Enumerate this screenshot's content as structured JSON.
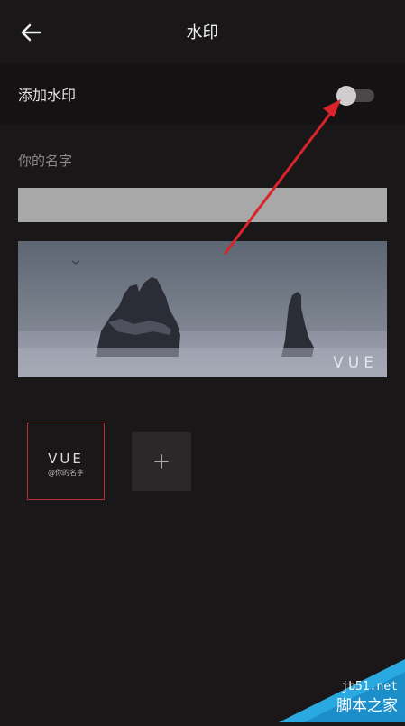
{
  "header": {
    "title": "水印",
    "back_icon": "arrow-left-icon"
  },
  "settings": {
    "add_watermark_label": "添加水印",
    "add_watermark_enabled": false,
    "name_label": "你的名字",
    "name_value": ""
  },
  "preview": {
    "watermark_text": "VUE"
  },
  "styles": {
    "thumb_title": "VUE",
    "thumb_subtitle": "@你的名字",
    "add_icon": "plus-icon"
  },
  "site_watermark": {
    "domain": "jb51.net",
    "name": "脚本之家"
  },
  "colors": {
    "background": "#1a1718",
    "toggle_row": "#151213",
    "selected_border": "#b8303a",
    "annotation_arrow": "#d8242a",
    "brand_corner": "#2aa9e0"
  }
}
